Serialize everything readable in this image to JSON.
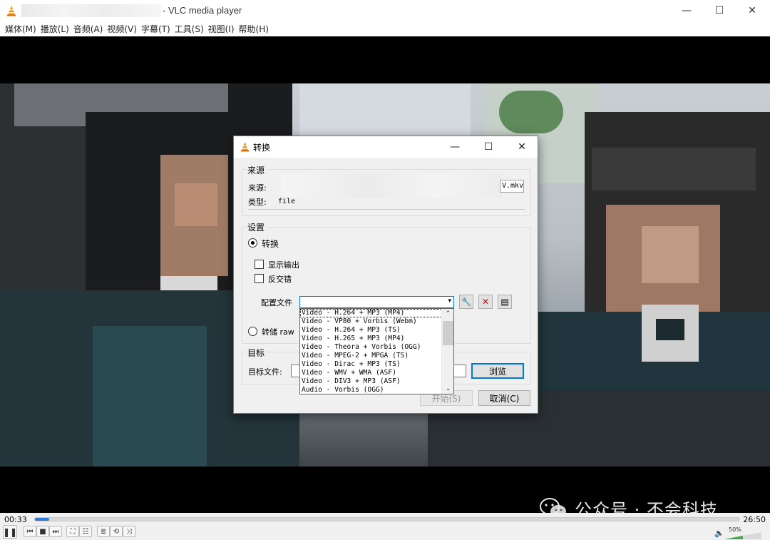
{
  "window": {
    "title": "- VLC media player",
    "min_glyph": "—",
    "max_glyph": "☐",
    "close_glyph": "✕"
  },
  "menu": [
    "媒体(M)",
    "播放(L)",
    "音频(A)",
    "视频(V)",
    "字幕(T)",
    "工具(S)",
    "视图(I)",
    "帮助(H)"
  ],
  "watermark": "公众号 · 不会科技",
  "controls": {
    "elapsed": "00:33",
    "total": "26:50",
    "progress": 0.02,
    "volume_label": "50%",
    "volume": 0.5
  },
  "dialog": {
    "title": "转换",
    "source_group": "来源",
    "source_label": "来源:",
    "source_tail": "V.mkv",
    "type_label": "类型:",
    "type_value": "file",
    "settings_group": "设置",
    "convert_radio": "转换",
    "show_output": "显示输出",
    "deinterlace": "反交错",
    "profile_label": "配置文件",
    "dump_raw": "转储 raw",
    "dest_group": "目标",
    "dest_label": "目标文件:",
    "browse": "浏览",
    "start": "开始(S)",
    "cancel": "取消(C)",
    "profiles": [
      "Video - H.264 + MP3 (MP4)",
      "Video - VP80 + Vorbis (Webm)",
      "Video - H.264 + MP3 (TS)",
      "Video - H.265 + MP3 (MP4)",
      "Video - Theora + Vorbis (OGG)",
      "Video - MPEG-2 + MPGA (TS)",
      "Video - Dirac + MP3 (TS)",
      "Video - WMV + WMA (ASF)",
      "Video - DIV3 + MP3 (ASF)",
      "Audio - Vorbis (OGG)"
    ]
  }
}
